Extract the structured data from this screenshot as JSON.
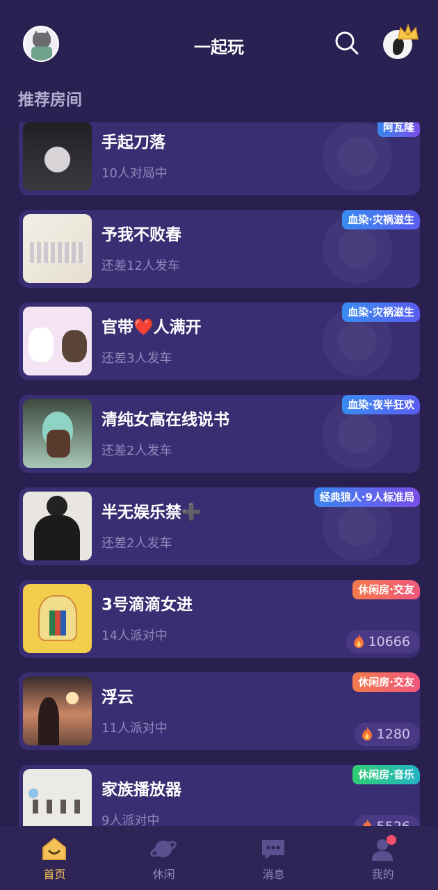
{
  "header": {
    "title": "一起玩",
    "section_title": "推荐房间"
  },
  "rooms": [
    {
      "name": "手起刀落",
      "status": "10人对局中",
      "tag": "阿瓦隆",
      "tag_color": "purple"
    },
    {
      "name": "予我不败春",
      "status": "还差12人发车",
      "tag": "血染·灾祸滋生",
      "tag_color": "blue"
    },
    {
      "name": "官带❤️人满开",
      "status": "还差3人发车",
      "tag": "血染·灾祸滋生",
      "tag_color": "blue"
    },
    {
      "name": "清纯女高在线说书",
      "status": "还差2人发车",
      "tag": "血染·夜半狂欢",
      "tag_color": "blue"
    },
    {
      "name": "半无娱乐禁➕",
      "status": "还差2人发车",
      "tag": "经典狼人·9人标准局",
      "tag_color": "purple"
    },
    {
      "name": "3号滴滴女进",
      "status": "14人派对中",
      "tag": "休闲房·交友",
      "tag_color": "orange",
      "heat": "10666"
    },
    {
      "name": "浮云",
      "status": "11人派对中",
      "tag": "休闲房·交友",
      "tag_color": "orange",
      "heat": "1280"
    },
    {
      "name": "家族播放器",
      "status": "9人派对中",
      "tag": "休闲房·音乐",
      "tag_color": "green",
      "heat": "5526"
    }
  ],
  "nav": {
    "home": "首页",
    "leisure": "休闲",
    "messages": "消息",
    "mine": "我的"
  },
  "colors": {
    "background": "#2a2050",
    "card": "#3a2e73",
    "active_nav": "#f5c25a",
    "badge": "#f2506a"
  }
}
